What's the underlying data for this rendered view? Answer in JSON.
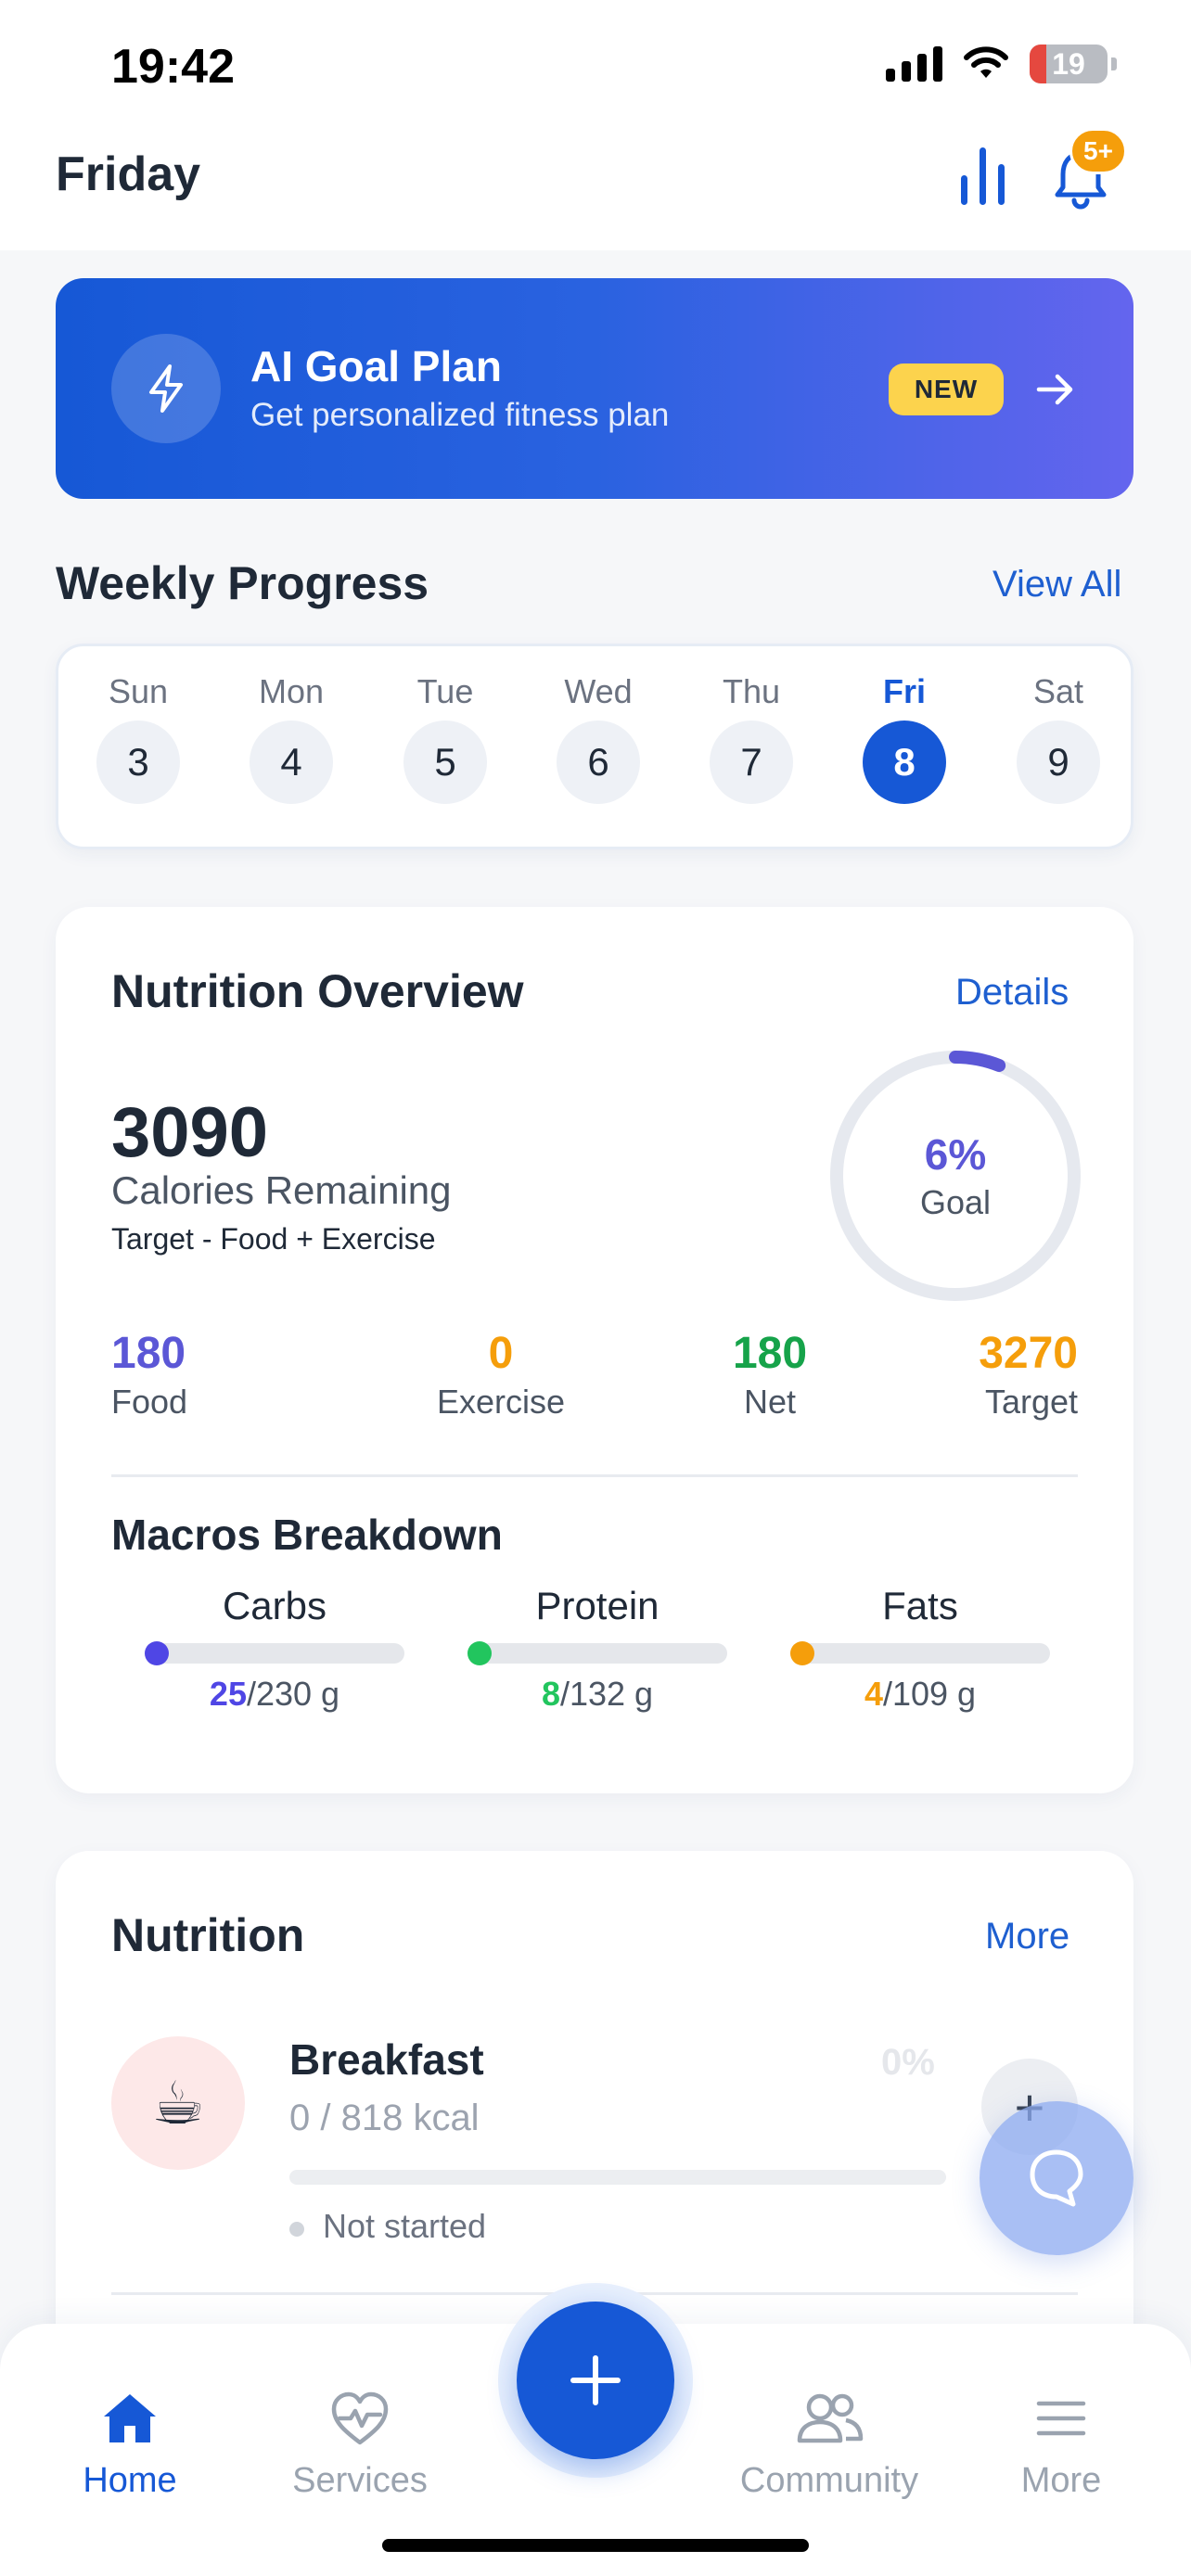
{
  "status_bar": {
    "time": "19:42",
    "battery": "19"
  },
  "header": {
    "title": "Friday",
    "notification_badge": "5+"
  },
  "goal_banner": {
    "title": "AI Goal Plan",
    "subtitle": "Get personalized fitness plan",
    "badge": "NEW"
  },
  "weekly": {
    "title": "Weekly Progress",
    "link": "View All",
    "days": [
      {
        "label": "Sun",
        "num": "3"
      },
      {
        "label": "Mon",
        "num": "4"
      },
      {
        "label": "Tue",
        "num": "5"
      },
      {
        "label": "Wed",
        "num": "6"
      },
      {
        "label": "Thu",
        "num": "7"
      },
      {
        "label": "Fri",
        "num": "8",
        "active": true
      },
      {
        "label": "Sat",
        "num": "9"
      }
    ]
  },
  "overview": {
    "title": "Nutrition Overview",
    "link": "Details",
    "calories": "3090",
    "calories_label": "Calories Remaining",
    "formula": "Target - Food + Exercise",
    "goal_pct": "6%",
    "goal_label": "Goal",
    "goal_fraction": 0.06,
    "stats": [
      {
        "value": "180",
        "label": "Food",
        "color": "#5b57d6"
      },
      {
        "value": "0",
        "label": "Exercise",
        "color": "#f59e0b"
      },
      {
        "value": "180",
        "label": "Net",
        "color": "#16a34a"
      },
      {
        "value": "3270",
        "label": "Target",
        "color": "#f59e0b"
      }
    ],
    "macros_title": "Macros Breakdown",
    "macros": [
      {
        "name": "Carbs",
        "value": "25",
        "total": "/230 g",
        "color": "#4f46e5",
        "fraction": 0.11
      },
      {
        "name": "Protein",
        "value": "8",
        "total": "/132 g",
        "color": "#22c55e",
        "fraction": 0.06
      },
      {
        "name": "Fats",
        "value": "4",
        "total": "/109 g",
        "color": "#f59e0b",
        "fraction": 0.04
      }
    ]
  },
  "nutrition": {
    "title": "Nutrition",
    "link": "More",
    "meal": {
      "icon": "☕",
      "name": "Breakfast",
      "kcal": "0 / 818 kcal",
      "pct": "0%",
      "status": "Not started",
      "progress": 0
    }
  },
  "nav": {
    "items": [
      {
        "label": "Home",
        "icon": "home-icon",
        "active": true
      },
      {
        "label": "Services",
        "icon": "heart-pulse-icon"
      },
      {
        "label": "Community",
        "icon": "users-icon"
      },
      {
        "label": "More",
        "icon": "menu-icon"
      }
    ]
  },
  "colors": {
    "primary": "#1658d6",
    "accent_purple": "#5b57d6",
    "badge_orange": "#f59e0b"
  }
}
